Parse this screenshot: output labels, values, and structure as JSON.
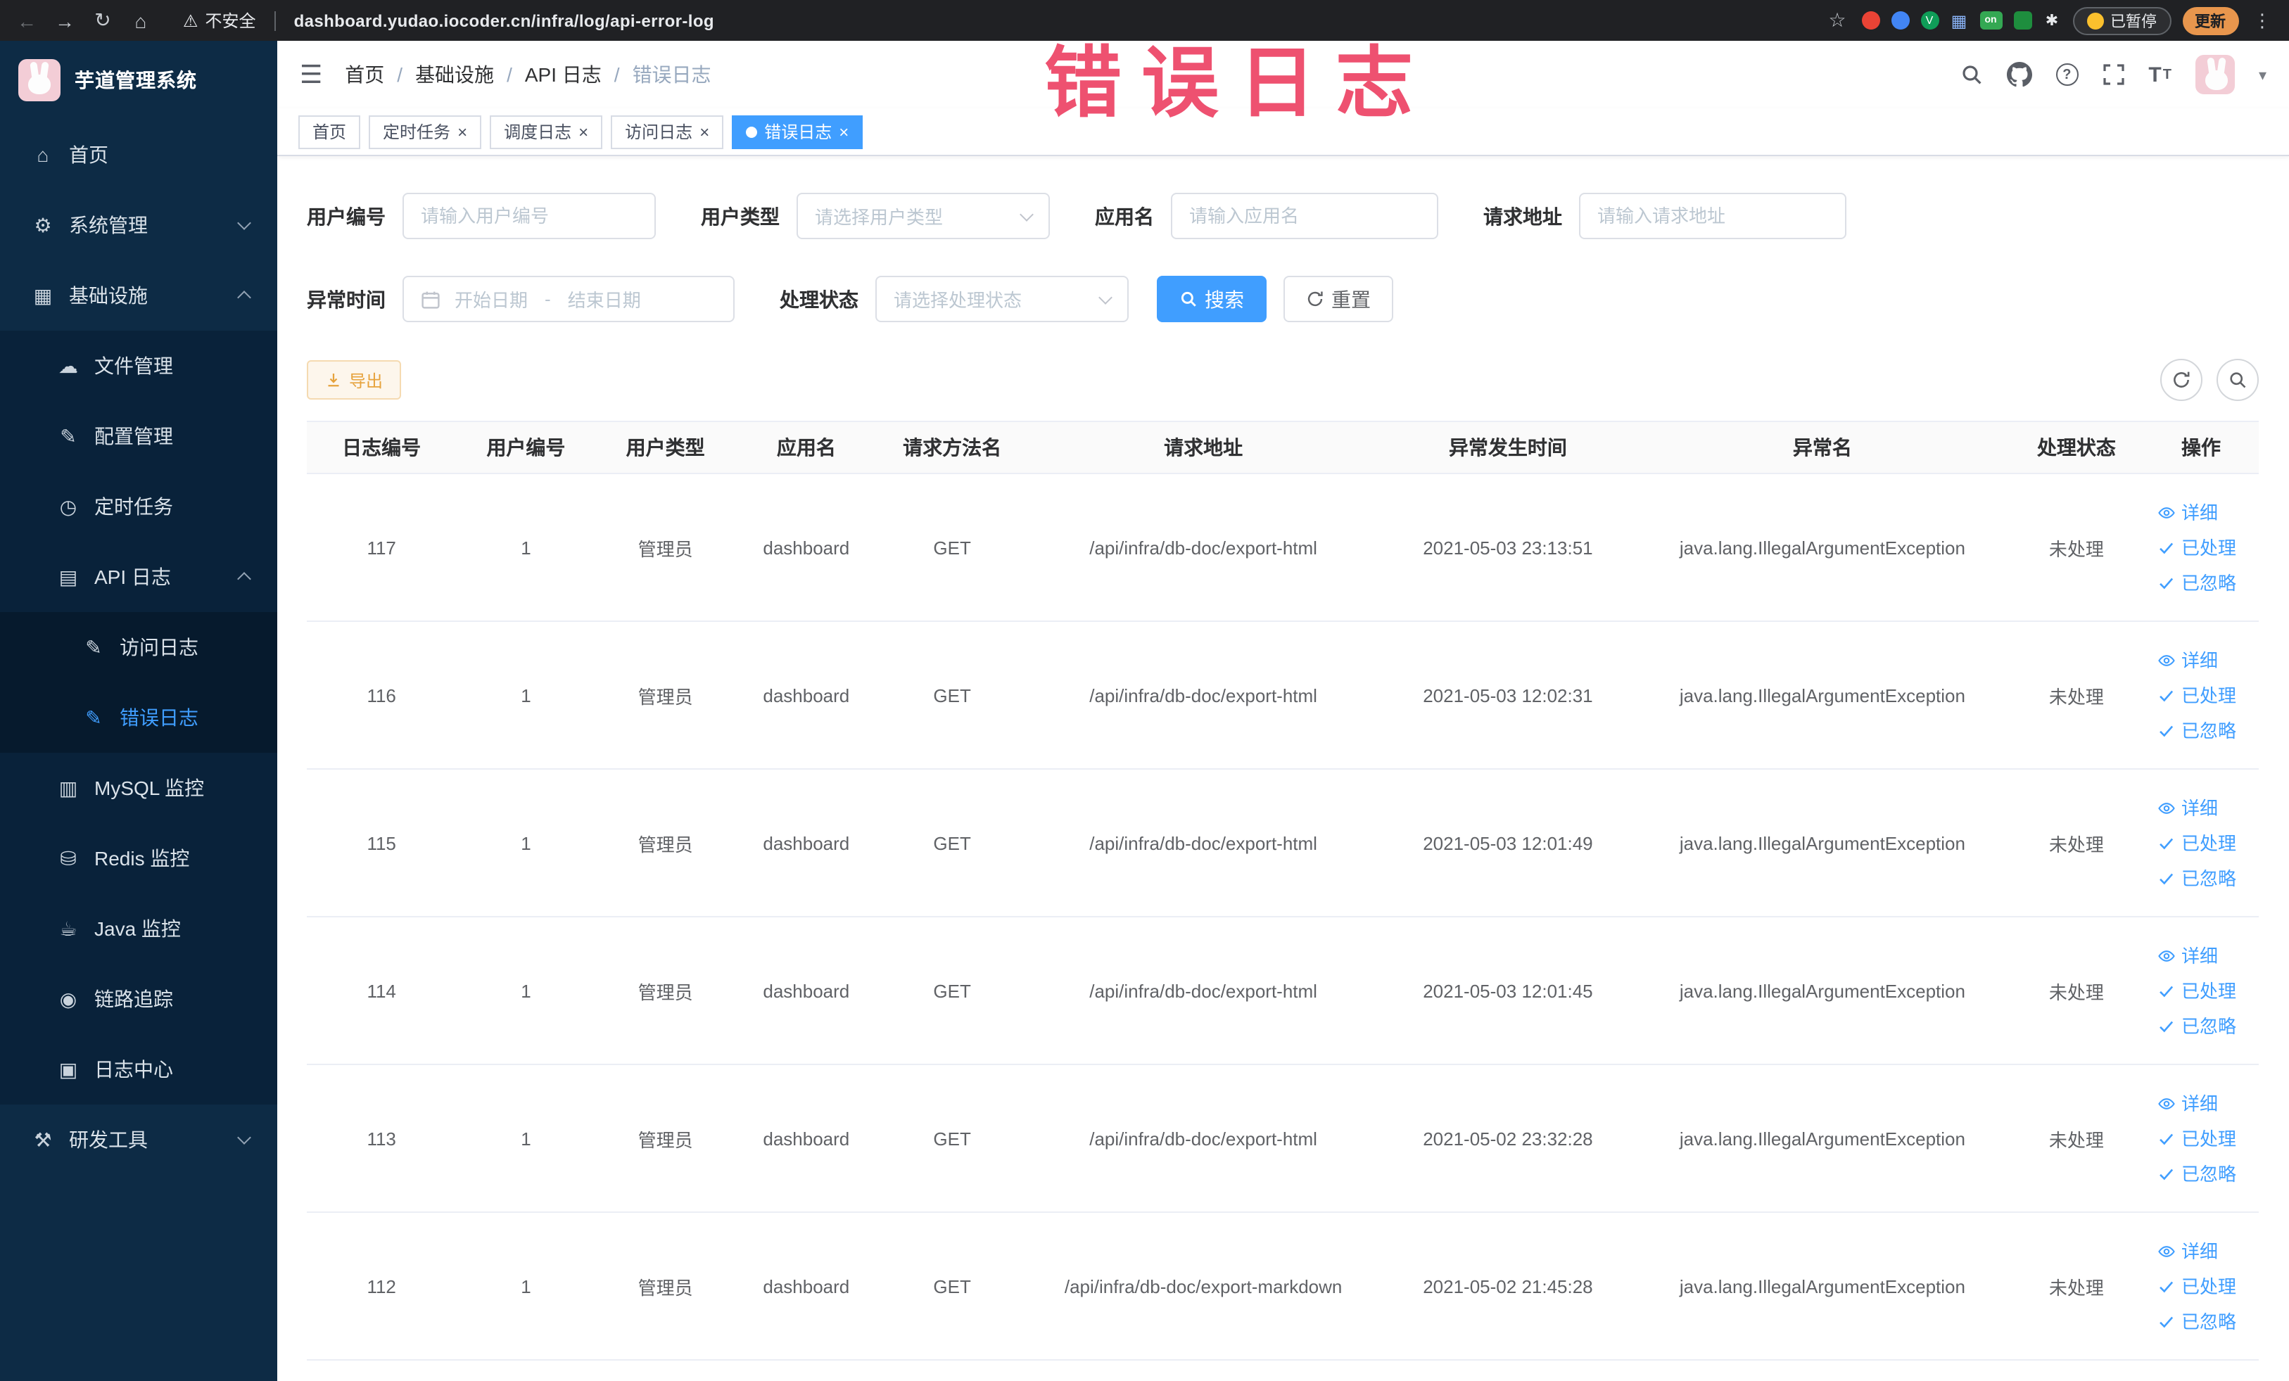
{
  "annotation": {
    "text": "错误日志"
  },
  "colors": {
    "accent": "#409eff",
    "sidebar_bg": "#0d2b45",
    "annotation_red": "#ee5170",
    "warning_button_text": "#e6a23c",
    "active_tab_bg": "#409eff"
  },
  "browser": {
    "security_label": "不安全",
    "url": "dashboard.yudao.iocoder.cn/infra/log/api-error-log",
    "extensions_on_badge": "on",
    "paused_badge": "已暂停",
    "update_button": "更新"
  },
  "sidebar": {
    "logo_title": "芋道管理系统",
    "menu": [
      {
        "label": "首页"
      },
      {
        "label": "系统管理"
      },
      {
        "label": "基础设施"
      },
      {
        "label": "文件管理"
      },
      {
        "label": "配置管理"
      },
      {
        "label": "定时任务"
      },
      {
        "label": "API 日志"
      },
      {
        "label": "访问日志"
      },
      {
        "label": "错误日志"
      },
      {
        "label": "MySQL 监控"
      },
      {
        "label": "Redis 监控"
      },
      {
        "label": "Java 监控"
      },
      {
        "label": "链路追踪"
      },
      {
        "label": "日志中心"
      },
      {
        "label": "研发工具"
      }
    ]
  },
  "breadcrumb": [
    "首页",
    "基础设施",
    "API 日志",
    "错误日志"
  ],
  "tabs": [
    {
      "label": "首页"
    },
    {
      "label": "定时任务"
    },
    {
      "label": "调度日志"
    },
    {
      "label": "访问日志"
    },
    {
      "label": "错误日志"
    }
  ],
  "filters": {
    "user_id_label": "用户编号",
    "user_id_placeholder": "请输入用户编号",
    "user_type_label": "用户类型",
    "user_type_placeholder": "请选择用户类型",
    "app_name_label": "应用名",
    "app_name_placeholder": "请输入应用名",
    "request_url_label": "请求地址",
    "request_url_placeholder": "请输入请求地址",
    "exception_time_label": "异常时间",
    "start_date_placeholder": "开始日期",
    "range_separator": "-",
    "end_date_placeholder": "结束日期",
    "process_status_label": "处理状态",
    "process_status_placeholder": "请选择处理状态",
    "search_button": "搜索",
    "reset_button": "重置"
  },
  "toolbar": {
    "export_button": "导出"
  },
  "table": {
    "columns": [
      "日志编号",
      "用户编号",
      "用户类型",
      "应用名",
      "请求方法名",
      "请求地址",
      "异常发生时间",
      "异常名",
      "处理状态",
      "操作"
    ],
    "actions": [
      "详细",
      "已处理",
      "已忽略"
    ],
    "rows": [
      {
        "id": "117",
        "user_id": "1",
        "user_type": "管理员",
        "app": "dashboard",
        "method": "GET",
        "url": "/api/infra/db-doc/export-html",
        "time": "2021-05-03 23:13:51",
        "exception": "java.lang.IllegalArgumentException",
        "status": "未处理"
      },
      {
        "id": "116",
        "user_id": "1",
        "user_type": "管理员",
        "app": "dashboard",
        "method": "GET",
        "url": "/api/infra/db-doc/export-html",
        "time": "2021-05-03 12:02:31",
        "exception": "java.lang.IllegalArgumentException",
        "status": "未处理"
      },
      {
        "id": "115",
        "user_id": "1",
        "user_type": "管理员",
        "app": "dashboard",
        "method": "GET",
        "url": "/api/infra/db-doc/export-html",
        "time": "2021-05-03 12:01:49",
        "exception": "java.lang.IllegalArgumentException",
        "status": "未处理"
      },
      {
        "id": "114",
        "user_id": "1",
        "user_type": "管理员",
        "app": "dashboard",
        "method": "GET",
        "url": "/api/infra/db-doc/export-html",
        "time": "2021-05-03 12:01:45",
        "exception": "java.lang.IllegalArgumentException",
        "status": "未处理"
      },
      {
        "id": "113",
        "user_id": "1",
        "user_type": "管理员",
        "app": "dashboard",
        "method": "GET",
        "url": "/api/infra/db-doc/export-html",
        "time": "2021-05-02 23:32:28",
        "exception": "java.lang.IllegalArgumentException",
        "status": "未处理"
      },
      {
        "id": "112",
        "user_id": "1",
        "user_type": "管理员",
        "app": "dashboard",
        "method": "GET",
        "url": "/api/infra/db-doc/export-markdown",
        "time": "2021-05-02 21:45:28",
        "exception": "java.lang.IllegalArgumentException",
        "status": "未处理"
      }
    ]
  }
}
